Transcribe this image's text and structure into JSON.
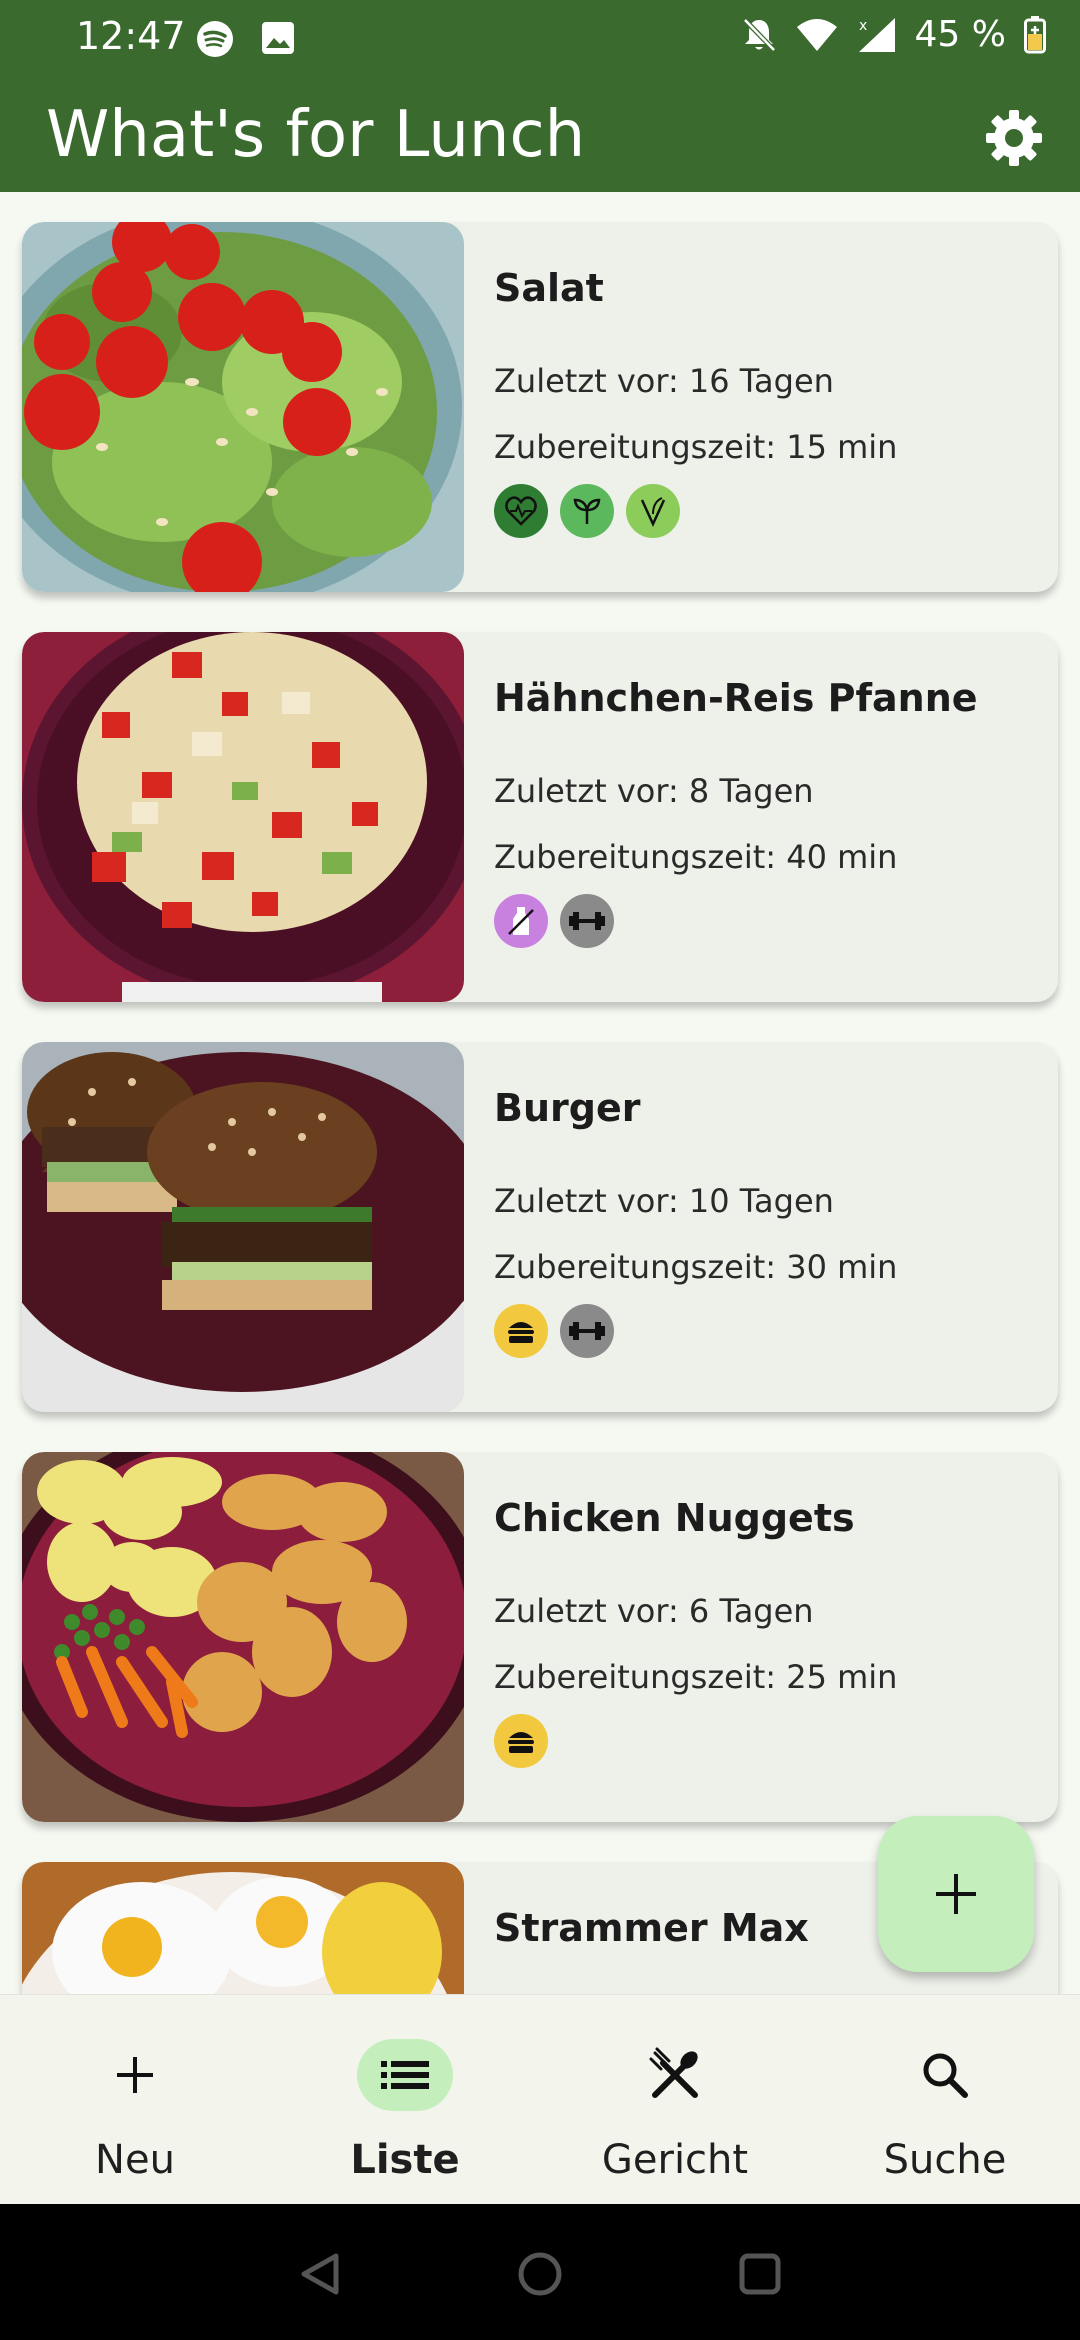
{
  "status_bar": {
    "time": "12:47",
    "battery": "45 %",
    "icons": [
      "spotify-icon",
      "image-icon",
      "mute-icon",
      "wifi-icon",
      "signal-icon",
      "battery-icon"
    ]
  },
  "app_bar": {
    "title": "What's for Lunch",
    "settings_icon": "gear-icon"
  },
  "colors": {
    "primary": "#3b6a2f",
    "accent_container": "#c4eebc",
    "card_bg": "#eef1ea"
  },
  "dishes": [
    {
      "name": "Salat",
      "last": "Zuletzt vor: 16 Tagen",
      "prep": "Zubereitungszeit: 15 min",
      "tags": [
        "heart-icon",
        "vegan-icon",
        "vegetarian-icon"
      ]
    },
    {
      "name": "Hähnchen-Reis Pfanne",
      "last": "Zuletzt vor: 8 Tagen",
      "prep": "Zubereitungszeit: 40 min",
      "tags": [
        "lactose-free-icon",
        "dumbbell-icon"
      ]
    },
    {
      "name": "Burger",
      "last": "Zuletzt vor: 10 Tagen",
      "prep": "Zubereitungszeit: 30 min",
      "tags": [
        "burger-icon",
        "dumbbell-icon"
      ]
    },
    {
      "name": "Chicken Nuggets",
      "last": "Zuletzt vor: 6 Tagen",
      "prep": "Zubereitungszeit: 25 min",
      "tags": [
        "burger-icon"
      ]
    },
    {
      "name": "Strammer Max",
      "last": "",
      "prep": "",
      "tags": []
    }
  ],
  "fab": {
    "icon": "plus-icon"
  },
  "bottom_nav": [
    {
      "label": "Neu",
      "icon": "plus-icon",
      "active": false
    },
    {
      "label": "Liste",
      "icon": "list-icon",
      "active": true
    },
    {
      "label": "Gericht",
      "icon": "cutlery-icon",
      "active": false
    },
    {
      "label": "Suche",
      "icon": "search-icon",
      "active": false
    }
  ]
}
